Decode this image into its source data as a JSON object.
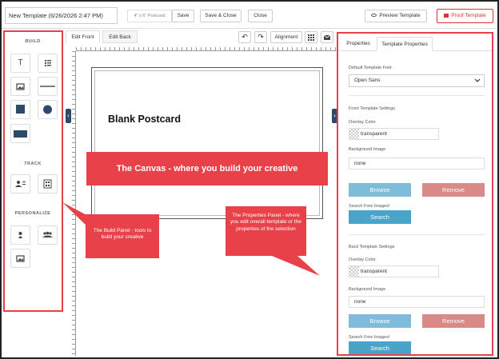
{
  "topbar": {
    "template_name": "New Template (6/26/2026 2:47 PM)",
    "size_label": "4\" x 6\" Postcard",
    "save": "Save",
    "save_close": "Save & Close",
    "close": "Close",
    "preview": "Preview Template",
    "proof": "Proof Template"
  },
  "build": {
    "build_label": "BUILD",
    "track_label": "TRACK",
    "personalize_label": "PERSONALIZE",
    "text_tool": "T"
  },
  "canvas": {
    "tab_front": "Edit Front",
    "tab_back": "Edit Back",
    "alignment": "Alignment",
    "postcard_title": "Blank Postcard",
    "undo_glyph": "↶",
    "redo_glyph": "↷",
    "left_arrow": "‹",
    "right_arrow": "›"
  },
  "callouts": {
    "canvas": "The Canvas - where you build your creative",
    "build": "The Build Panel - tools to build your creative",
    "properties": "The Properties Panel - where you edit overall template or the properties of the selection"
  },
  "properties": {
    "tab_properties": "Properties",
    "tab_template": "Template Properties",
    "default_font_label": "Default Template Font",
    "default_font_value": "Open Sans",
    "front_settings": "Front Template Settings",
    "overlay_color_label": "Overlay Color",
    "overlay_value": "transparent",
    "bg_image_label": "Background Image",
    "bg_image_value": "none",
    "browse": "Browse",
    "remove": "Remove",
    "search_free": "Search Free Images!",
    "search": "Search",
    "back_settings": "Back Template Settings",
    "back_overlay_label": "Overlay Color",
    "back_overlay_value": "transparent",
    "back_bg_label": "Background Image",
    "back_bg_value": "none",
    "back_browse": "Browse",
    "back_remove": "Remove",
    "back_search_free": "Search Free Images!",
    "back_search": "Search"
  },
  "colors": {
    "accent_red": "#e8414a",
    "browse_blue": "#7fbcd9",
    "search_blue": "#4aa3c9",
    "remove_red": "#d98a86",
    "shape_navy": "#2e4a6b"
  }
}
